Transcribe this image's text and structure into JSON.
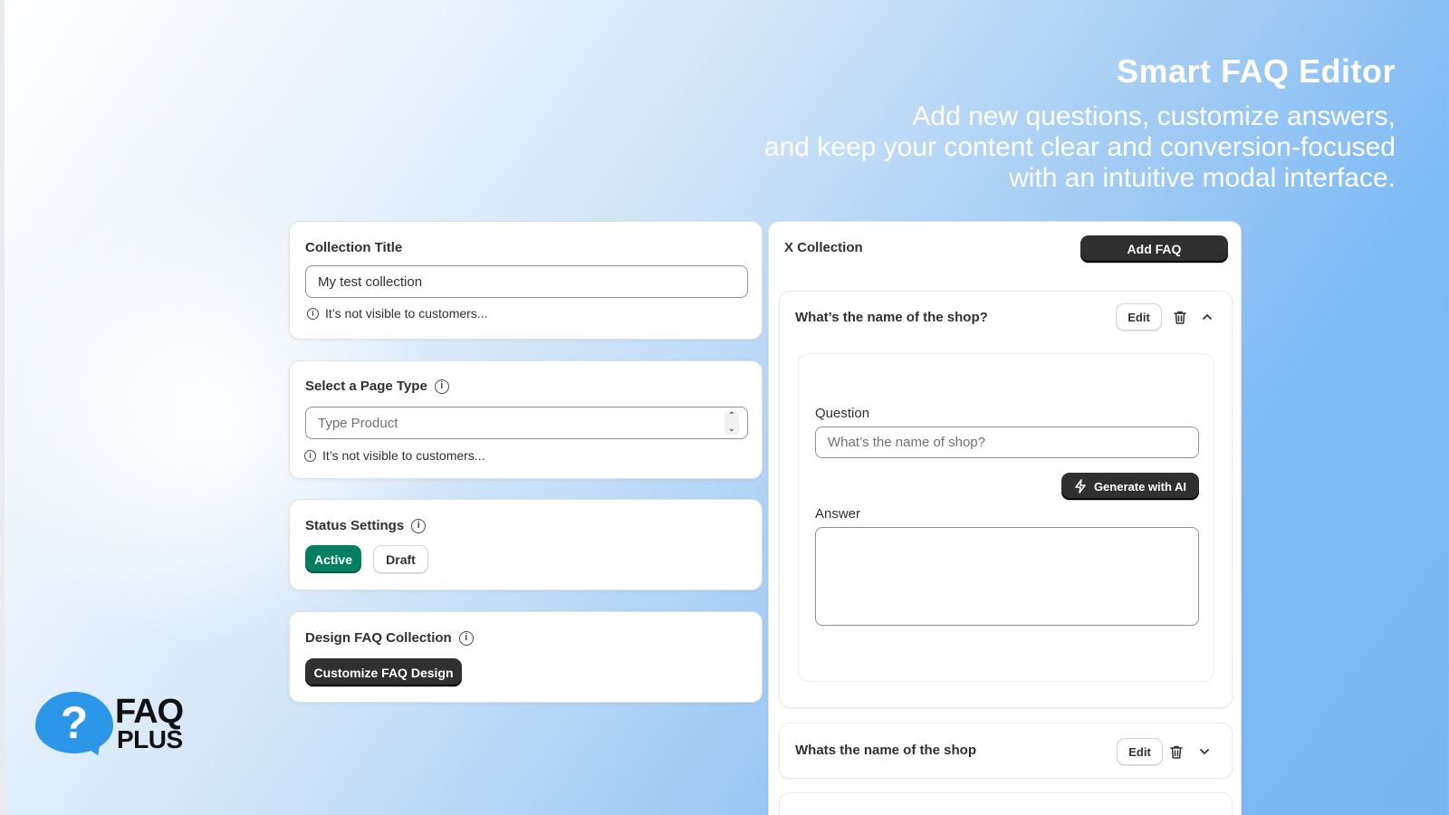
{
  "hero": {
    "title": "Smart FAQ Editor",
    "line1": "Add new questions, customize answers,",
    "line2": "and keep your content clear and conversion-focused",
    "line3": "with an intuitive modal interface."
  },
  "collection_title_card": {
    "label": "Collection Title",
    "input_value": "My test collection",
    "hint": "It’s not visible to customers..."
  },
  "page_type_card": {
    "label": "Select a Page Type",
    "select_placeholder": "Type Product",
    "hint": "It’s not visible to customers..."
  },
  "status_card": {
    "label": "Status Settings",
    "active_label": "Active",
    "draft_label": "Draft",
    "active_color": "#008060"
  },
  "design_card": {
    "label": "Design FAQ Collection",
    "button_label": "Customize FAQ Design"
  },
  "faq_panel": {
    "title": "X Collection",
    "add_button": "Add FAQ",
    "items": [
      {
        "question": "What’s the name of the shop?",
        "edit_label": "Edit",
        "expanded": true,
        "editor": {
          "question_label": "Question",
          "question_placeholder": "What’s the name of shop?",
          "generate_label": "Generate with AI",
          "answer_label": "Answer",
          "answer_value": ""
        }
      },
      {
        "question": "Whats the name of the shop",
        "edit_label": "Edit",
        "expanded": false
      }
    ]
  },
  "logo": {
    "word1": "FAQ",
    "word2": "PLUS",
    "brand_color": "#2c97e8"
  },
  "icons": {
    "info": "info-circle-icon",
    "delete": "trash-icon",
    "collapse": "chevron-up-icon",
    "expand": "chevron-down-icon",
    "ai": "lightning-icon",
    "stepper": "select-stepper-icon"
  }
}
